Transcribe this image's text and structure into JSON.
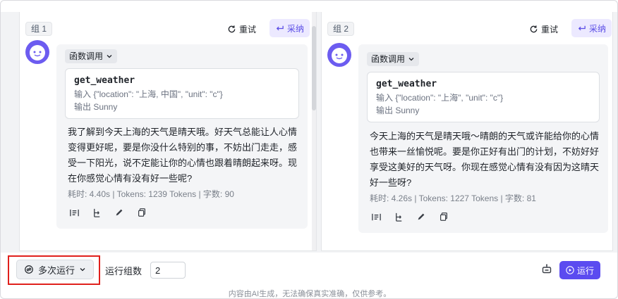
{
  "groups": [
    {
      "tag": "组 1",
      "retry_label": "重试",
      "adopt_label": "采纳",
      "function_call_toggle": "函数调用",
      "function_name": "get_weather",
      "input_line": "输入 {\"location\": \"上海, 中国\", \"unit\": \"c\"}",
      "output_line": "输出 Sunny",
      "reply": "我了解到今天上海的天气是晴天哦。好天气总能让人心情变得更好呢，要是你没什么特别的事，不妨出门走走，感受一下阳光，说不定能让你的心情也跟着晴朗起来呀。现在你感觉心情有没有好一些呢?",
      "stats": "耗时: 4.40s | Tokens: 1239 Tokens | 字数: 90"
    },
    {
      "tag": "组 2",
      "retry_label": "重试",
      "adopt_label": "采纳",
      "function_call_toggle": "函数调用",
      "function_name": "get_weather",
      "input_line": "输入 {\"location\": \"上海\", \"unit\": \"c\"}",
      "output_line": "输出 Sunny",
      "reply": "今天上海的天气是晴天哦～晴朗的天气或许能给你的心情也带来一丝愉悦呢。要是你正好有出门的计划，不妨好好享受这美好的天气呀。你现在感觉心情有没有因为这晴天好一些呀?",
      "stats": "耗时: 4.26s | Tokens: 1227 Tokens | 字数: 81"
    }
  ],
  "bottom": {
    "multi_run_label": "多次运行",
    "run_groups_label": "运行组数",
    "run_groups_value": "2",
    "run_label": "运行",
    "disclaimer": "内容由AI生成，无法确保真实准确，仅供参考。"
  },
  "colors": {
    "accent": "#5b4bf0",
    "avatar": "#6c5cf0",
    "highlight": "#e0201c"
  },
  "icons": [
    "retry-icon",
    "adopt-icon",
    "chevron-down-icon",
    "align-icon",
    "branch-icon",
    "edit-icon",
    "copy-icon",
    "multi-run-icon",
    "robot-icon",
    "play-icon",
    "avatar-icon"
  ]
}
